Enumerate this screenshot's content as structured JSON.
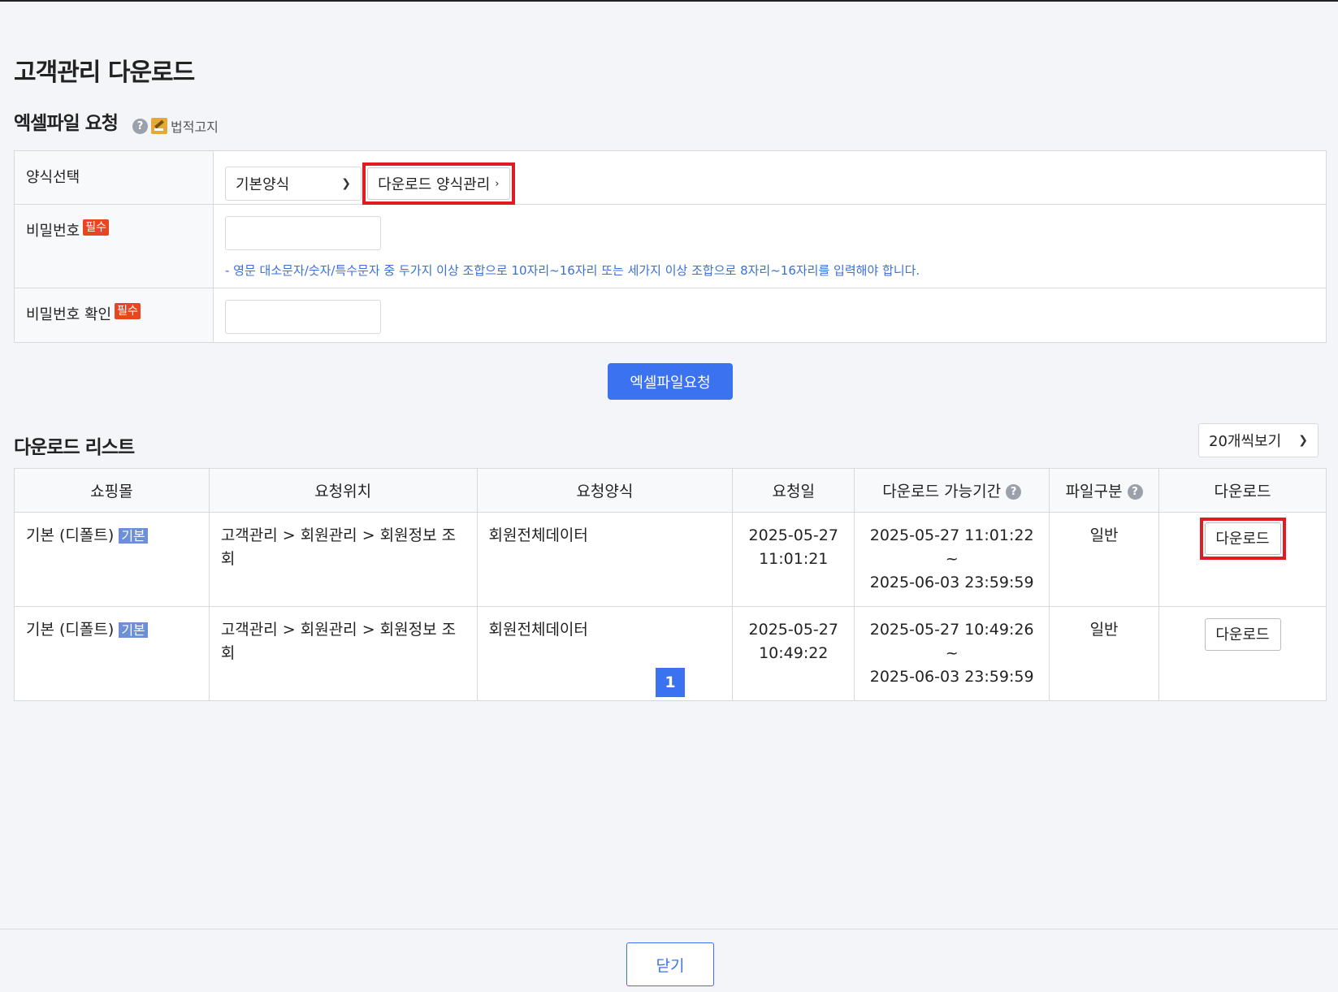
{
  "page_title": "고객관리 다운로드",
  "request_section": {
    "title": "엑셀파일 요청",
    "help_icon_label": "?",
    "legal_label": "법적고지",
    "rows": {
      "template": {
        "label": "양식선택",
        "select_value": "기본양식",
        "manage_button": "다운로드 양식관리"
      },
      "password": {
        "label": "비밀번호",
        "required_badge": "필수",
        "value": "",
        "hint": "- 영문 대소문자/숫자/특수문자 중 두가지 이상 조합으로 10자리~16자리 또는 세가지 이상 조합으로 8자리~16자리를 입력해야 합니다."
      },
      "password_confirm": {
        "label": "비밀번호 확인",
        "required_badge": "필수",
        "value": ""
      }
    },
    "submit_button": "엑셀파일요청"
  },
  "list_section": {
    "title": "다운로드 리스트",
    "per_page": "20개씩보기",
    "columns": [
      "쇼핑몰",
      "요청위치",
      "요청양식",
      "요청일",
      "다운로드 가능기간",
      "파일구분",
      "다운로드"
    ],
    "rows": [
      {
        "mall": "기본 (디폴트)",
        "mall_badge": "기본",
        "location": "고객관리 > 회원관리 > 회원정보 조회",
        "template": "회원전체데이터",
        "date": "2025-05-27",
        "time": "11:01:21",
        "period_start": "2025-05-27 11:01:22 ~",
        "period_end": "2025-06-03 23:59:59",
        "file_type": "일반",
        "download_label": "다운로드"
      },
      {
        "mall": "기본 (디폴트)",
        "mall_badge": "기본",
        "location": "고객관리 > 회원관리 > 회원정보 조회",
        "template": "회원전체데이터",
        "date": "2025-05-27",
        "time": "10:49:22",
        "period_start": "2025-05-27 10:49:26 ~",
        "period_end": "2025-06-03 23:59:59",
        "file_type": "일반",
        "download_label": "다운로드"
      }
    ]
  },
  "pagination": {
    "current": "1"
  },
  "footer": {
    "close_button": "닫기"
  },
  "colors": {
    "primary": "#3a72f0",
    "highlight": "#e01b24",
    "required": "#e8461e",
    "hint": "#3b6fd9"
  }
}
